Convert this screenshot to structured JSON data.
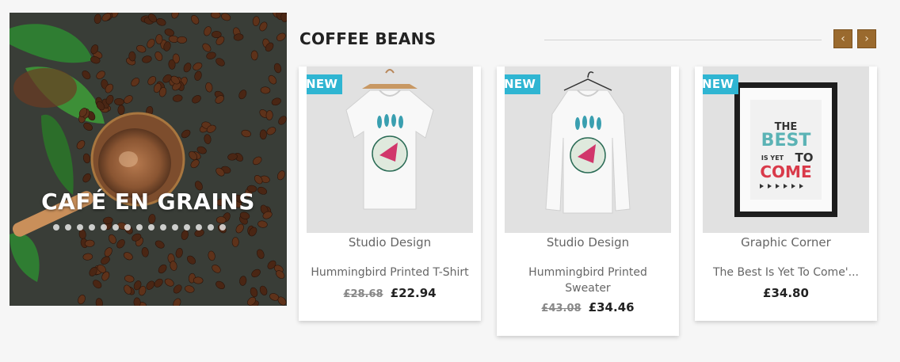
{
  "banner": {
    "title": "CAFÉ EN GRAINS",
    "dots_count": 15
  },
  "section": {
    "title": "COFFEE BEANS",
    "prev_icon": "chevron-left-icon",
    "next_icon": "chevron-right-icon",
    "prev_glyph": "‹",
    "next_glyph": "›"
  },
  "products": [
    {
      "badge": "NEW",
      "brand": "Studio Design",
      "name": "Hummingbird Printed T-Shirt",
      "old_price": "£28.68",
      "price": "£22.94",
      "image": "t-shirt"
    },
    {
      "badge": "NEW",
      "brand": "Studio Design",
      "name": "Hummingbird Printed Sweater",
      "old_price": "£43.08",
      "price": "£34.46",
      "image": "sweater"
    },
    {
      "badge": "NEW",
      "brand": "Graphic Corner",
      "name": "The Best Is Yet To Come'...",
      "old_price": "",
      "price": "£34.80",
      "image": "framed-poster",
      "poster": {
        "line1": "THE",
        "line2": "BEST",
        "line3": "IS YET",
        "line4": "TO",
        "line5": "COME"
      }
    }
  ],
  "colors": {
    "badge": "#2fb5d2",
    "nav_button": "#9a6a2e",
    "background": "#f6f6f6"
  }
}
